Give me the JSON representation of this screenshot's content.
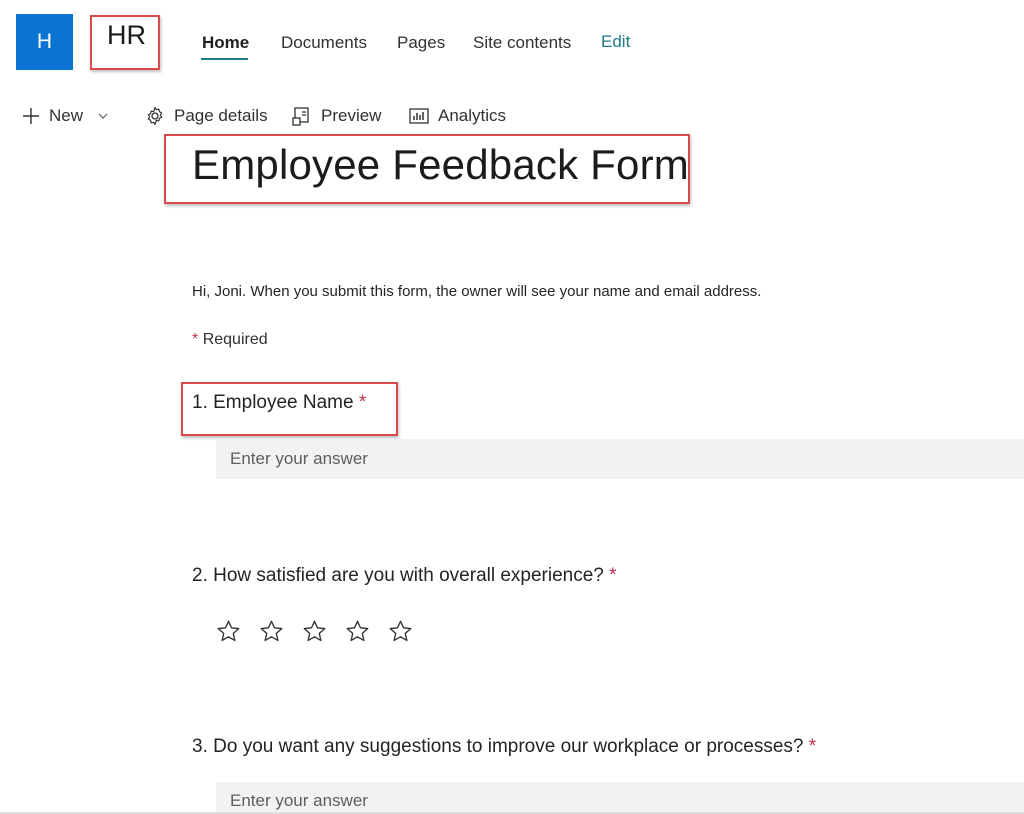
{
  "site": {
    "logo_letter": "H",
    "title": "HR"
  },
  "nav": {
    "items": [
      {
        "label": "Home",
        "active": true
      },
      {
        "label": "Documents"
      },
      {
        "label": "Pages"
      },
      {
        "label": "Site contents"
      },
      {
        "label": "Edit"
      }
    ]
  },
  "commands": {
    "new": "New",
    "page_details": "Page details",
    "preview": "Preview",
    "analytics": "Analytics"
  },
  "page": {
    "title": "Employee Feedback Form"
  },
  "form": {
    "intro": "Hi, Joni. When you submit this form, the owner will see your name and email address.",
    "required_marker": "*",
    "required_label": "Required",
    "questions": [
      {
        "text": "1. Employee Name",
        "type": "text",
        "placeholder": "Enter your answer"
      },
      {
        "text": "2. How satisfied are you with overall experience?",
        "type": "rating",
        "rating_max": 5,
        "rating_value": 0
      },
      {
        "text": "3. Do you want any suggestions to improve our workplace or processes?",
        "type": "text",
        "placeholder": "Enter your answer"
      }
    ]
  },
  "colors": {
    "brand": "#0a74d3",
    "accent": "#1d7a8a",
    "required": "#c4314b",
    "highlight_box": "#d94a4a"
  },
  "icons": [
    "plus-icon",
    "chevron-down-icon",
    "gear-icon",
    "preview-icon",
    "analytics-icon",
    "star-outline-icon"
  ]
}
